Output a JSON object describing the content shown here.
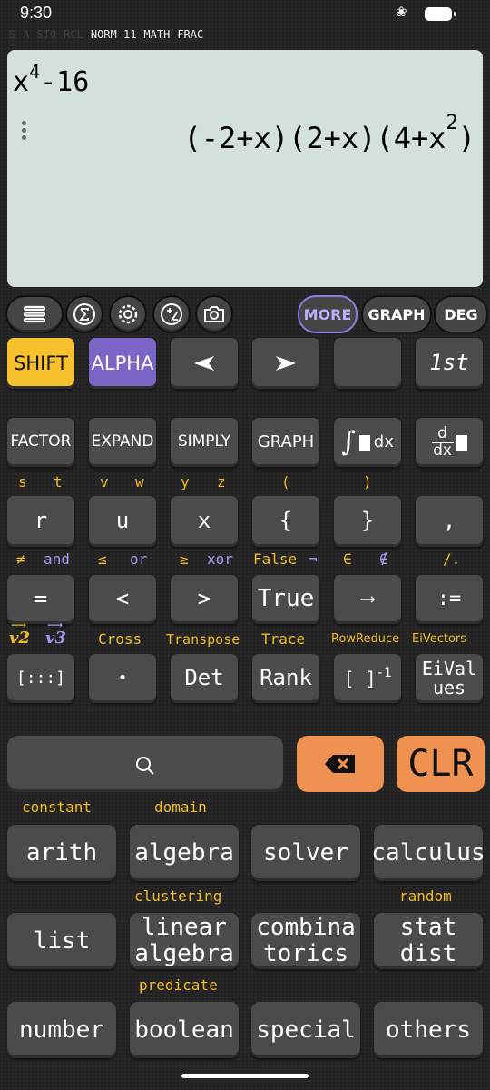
{
  "status": {
    "time": "9:30"
  },
  "indicators": [
    {
      "text": "S",
      "on": false
    },
    {
      "text": "A",
      "on": false
    },
    {
      "text": "STO",
      "on": false
    },
    {
      "text": "RCL",
      "on": false
    },
    {
      "text": "NORM-11",
      "on": true
    },
    {
      "text": "MATH",
      "on": true
    },
    {
      "text": "FRAC",
      "on": true
    }
  ],
  "display": {
    "input_base": "x",
    "input_exp": "4",
    "input_rest": "-16",
    "result_main": "(-2+x)(2+x)(4+x",
    "result_exp": "2",
    "result_close": ")"
  },
  "toolbar": {
    "more": "MORE",
    "graph": "GRAPH",
    "deg": "DEG"
  },
  "row1": {
    "shift": "SHIFT",
    "alpha": "ALPHA",
    "left": "◀",
    "right": "▶",
    "blank": "",
    "first": "1st"
  },
  "row2": {
    "factor": "FACTOR",
    "expand": "EXPAND",
    "simply": "SIMPLY",
    "graph": "GRAPH",
    "integral_dx": "dx",
    "deriv_d": "d",
    "deriv_dx": "dx"
  },
  "labels3": {
    "s": "s",
    "t": "t",
    "v": "v",
    "w": "w",
    "y": "y",
    "z": "z",
    "lparen": "(",
    "rparen": ")"
  },
  "row3": {
    "r": "r",
    "u": "u",
    "x": "x",
    "lbrace": "{",
    "rbrace": "}",
    "comma": ","
  },
  "labels4": {
    "ne": "≠",
    "and": "and",
    "le": "≤",
    "or": "or",
    "ge": "≥",
    "xor": "xor",
    "false": "False",
    "not": "¬",
    "in": "∈",
    "notin": "∉",
    "slash": "/."
  },
  "row4": {
    "eq": "=",
    "lt": "<",
    "gt": ">",
    "true": "True",
    "arrow": "⟶",
    "assign": ":="
  },
  "labels5": {
    "v2": "v2",
    "v3": "v3",
    "cross": "Cross",
    "transpose": "Transpose",
    "trace": "Trace",
    "rowreduce": "RowReduce",
    "eivectors": "EiVectors"
  },
  "row5": {
    "matrix": "[:::]",
    "dot": "•",
    "det": "Det",
    "rank": "Rank",
    "inv_bracket": "[ ]",
    "inv_exp": "-1",
    "eivalues_1": "EiVal",
    "eivalues_2": "ues"
  },
  "search": {
    "clr": "CLR"
  },
  "cat_labels": {
    "constant": "constant",
    "domain": "domain",
    "clustering": "clustering",
    "random": "random",
    "predicate": "predicate"
  },
  "cats": {
    "arith": "arith",
    "algebra": "algebra",
    "solver": "solver",
    "calculus": "calculus",
    "list": "list",
    "linear_1": "linear",
    "linear_2": "algebra",
    "combi_1": "combina",
    "combi_2": "torics",
    "stat_1": "stat",
    "stat_2": "dist",
    "number": "number",
    "boolean": "boolean",
    "special": "special",
    "others": "others"
  },
  "colors": {
    "shift": "#f6c12c",
    "alpha": "#7b66c7",
    "orange": "#ef9251",
    "display": "#d3e0dd",
    "yellow_label": "#f2bb23",
    "purple_label": "#a997f5"
  }
}
